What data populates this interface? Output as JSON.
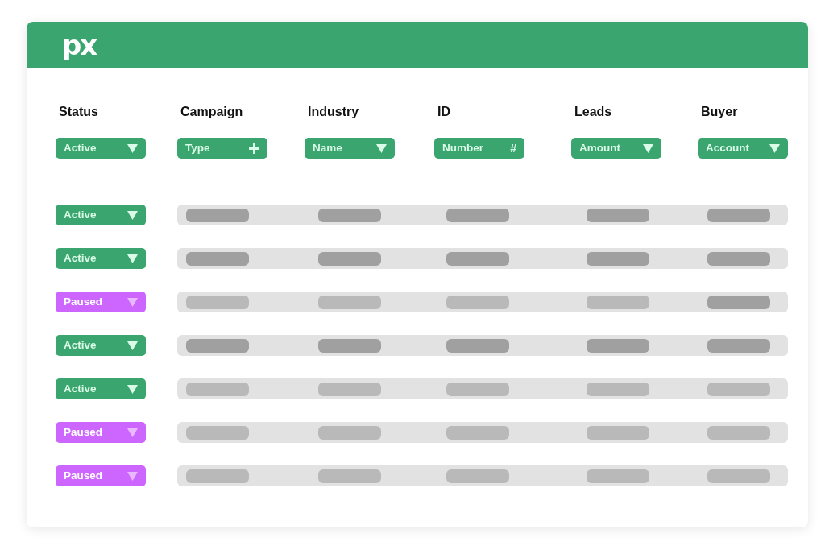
{
  "header": {
    "logo": "px"
  },
  "columns": [
    {
      "title": "Status",
      "filter": {
        "label": "Active",
        "kind": "dropdown"
      }
    },
    {
      "title": "Campaign",
      "filter": {
        "label": "Type",
        "kind": "add"
      }
    },
    {
      "title": "Industry",
      "filter": {
        "label": "Name",
        "kind": "dropdown"
      }
    },
    {
      "title": "ID",
      "filter": {
        "label": "Number",
        "kind": "symbol",
        "symbol": "#"
      }
    },
    {
      "title": "Leads",
      "filter": {
        "label": "Amount",
        "kind": "dropdown"
      }
    },
    {
      "title": "Buyer",
      "filter": {
        "label": "Account",
        "kind": "dropdown"
      }
    }
  ],
  "rows": [
    {
      "status": {
        "label": "Active",
        "kind": "active"
      },
      "bars": [
        {
          "dim": false
        },
        {
          "dim": false
        },
        {
          "dim": false
        },
        {
          "dim": false
        },
        {
          "dim": false
        }
      ]
    },
    {
      "status": {
        "label": "Active",
        "kind": "active"
      },
      "bars": [
        {
          "dim": false
        },
        {
          "dim": false
        },
        {
          "dim": false
        },
        {
          "dim": false
        },
        {
          "dim": false
        }
      ]
    },
    {
      "status": {
        "label": "Paused",
        "kind": "paused"
      },
      "bars": [
        {
          "dim": true
        },
        {
          "dim": true
        },
        {
          "dim": true
        },
        {
          "dim": true
        },
        {
          "dim": false
        }
      ]
    },
    {
      "status": {
        "label": "Active",
        "kind": "active"
      },
      "bars": [
        {
          "dim": false
        },
        {
          "dim": false
        },
        {
          "dim": false
        },
        {
          "dim": false
        },
        {
          "dim": false
        }
      ]
    },
    {
      "status": {
        "label": "Active",
        "kind": "active"
      },
      "bars": [
        {
          "dim": true
        },
        {
          "dim": true
        },
        {
          "dim": true
        },
        {
          "dim": true
        },
        {
          "dim": true
        }
      ]
    },
    {
      "status": {
        "label": "Paused",
        "kind": "paused"
      },
      "bars": [
        {
          "dim": true
        },
        {
          "dim": true
        },
        {
          "dim": true
        },
        {
          "dim": true
        },
        {
          "dim": true
        }
      ]
    },
    {
      "status": {
        "label": "Paused",
        "kind": "paused"
      },
      "bars": [
        {
          "dim": true
        },
        {
          "dim": true
        },
        {
          "dim": true
        },
        {
          "dim": true
        },
        {
          "dim": true
        }
      ]
    }
  ]
}
